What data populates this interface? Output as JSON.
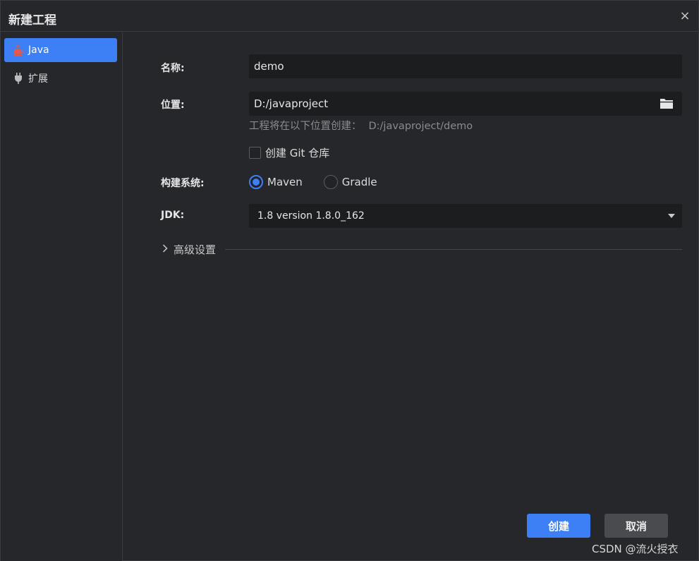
{
  "dialog": {
    "title": "新建工程",
    "close_icon": "×"
  },
  "sidebar": {
    "items": [
      {
        "label": "Java",
        "icon": "java-cup-icon",
        "active": true
      },
      {
        "label": "扩展",
        "icon": "plug-icon",
        "active": false
      }
    ]
  },
  "form": {
    "name_label": "名称:",
    "name_value": "demo",
    "location_label": "位置:",
    "location_value": "D:/javaproject",
    "location_hint_prefix": "工程将在以下位置创建：",
    "location_hint_path": "D:/javaproject/demo",
    "git_checkbox_label": "创建 Git 仓库",
    "git_checked": false,
    "build_label": "构建系统:",
    "build_options": [
      {
        "label": "Maven",
        "checked": true
      },
      {
        "label": "Gradle",
        "checked": false
      }
    ],
    "jdk_label": "JDK:",
    "jdk_value": "1.8 version 1.8.0_162",
    "advanced_label": "高级设置"
  },
  "buttons": {
    "create": "创建",
    "cancel": "取消"
  },
  "watermark": "CSDN @流火授衣",
  "colors": {
    "accent": "#3d7ff5",
    "background": "#26272a",
    "field": "#1c1d1f"
  }
}
